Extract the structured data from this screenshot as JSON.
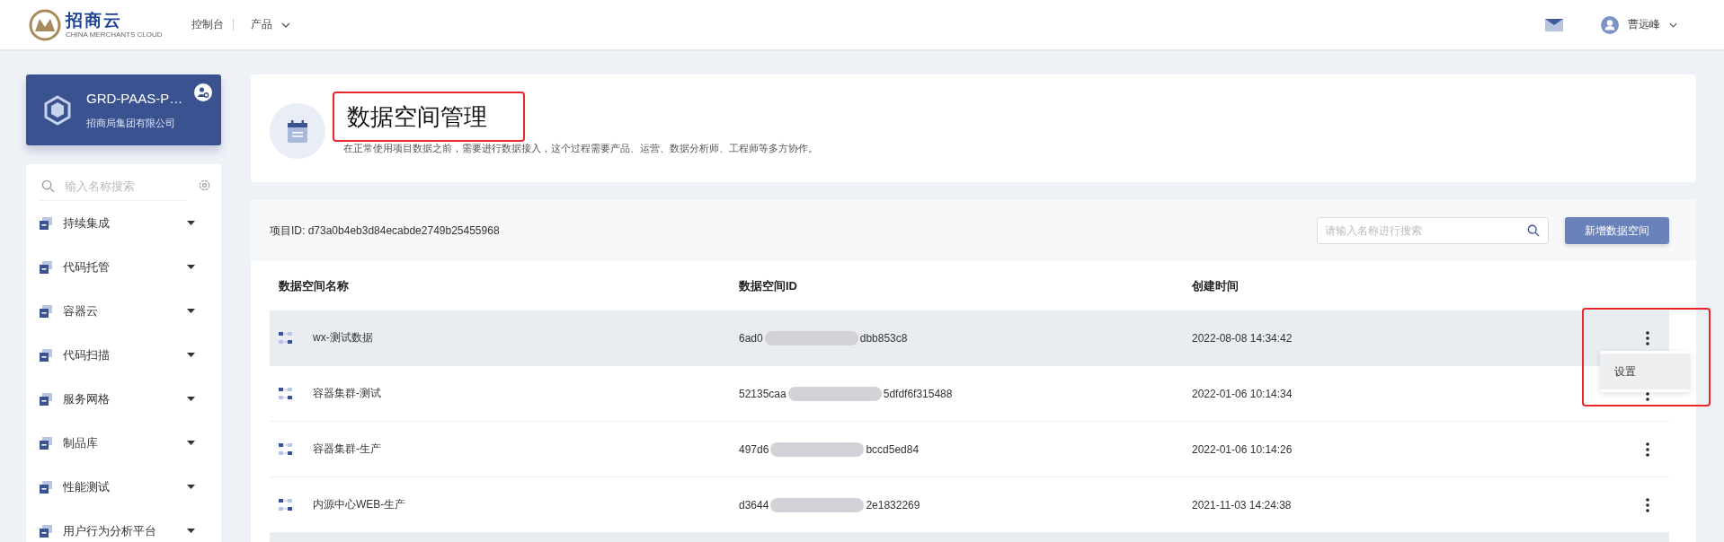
{
  "topbar": {
    "brand": "招商云",
    "brand_sub": "CHINA MERCHANTS CLOUD",
    "nav": [
      "控制台",
      "产品"
    ],
    "user": "曹远峰"
  },
  "project": {
    "name": "GRD-PAAS-P…",
    "org": "招商局集团有限公司"
  },
  "sidebar": {
    "search": {
      "placeholder": "输入名称搜索"
    },
    "items": [
      {
        "label": "持续集成"
      },
      {
        "label": "代码托管"
      },
      {
        "label": "容器云"
      },
      {
        "label": "代码扫描"
      },
      {
        "label": "服务网格"
      },
      {
        "label": "制品库"
      },
      {
        "label": "性能测试"
      },
      {
        "label": "用户行为分析平台"
      }
    ]
  },
  "header": {
    "title": "数据空间管理",
    "title_highlighted": true,
    "description": "在正常使用项目数据之前，需要进行数据接入，这个过程需要产品、运营、数据分析师、工程师等多方协作。"
  },
  "toolbar": {
    "project_id": "项目ID: d73a0b4eb3d84ecabde2749b25455968",
    "search": {
      "placeholder": "请输入名称进行搜索"
    },
    "add_button": "新增数据空间"
  },
  "table": {
    "columns": [
      "数据空间名称",
      "数据空间ID",
      "创建时间"
    ],
    "rows": [
      {
        "name": "wx-测试数据",
        "id_start": "6ad0",
        "id_end": "dbb853c8",
        "time": "2022-08-08 14:34:42",
        "selected": true,
        "action_highlighted": true,
        "menu": [
          {
            "label": "设置",
            "selected": true
          }
        ]
      },
      {
        "name": "容器集群-测试",
        "id_start": "52135caa",
        "id_end": "5dfdf6f315488",
        "time": "2022-01-06 10:14:34",
        "selected": false,
        "action_highlighted": false
      },
      {
        "name": "容器集群-生产",
        "id_start": "497d6",
        "id_end": "bccd5ed84",
        "time": "2022-01-06 10:14:26",
        "selected": false,
        "action_highlighted": false
      },
      {
        "name": "内源中心WEB-生产",
        "id_start": "d3644",
        "id_end": "2e1832269",
        "time": "2021-11-03 14:24:38",
        "selected": false,
        "action_highlighted": false
      }
    ]
  }
}
